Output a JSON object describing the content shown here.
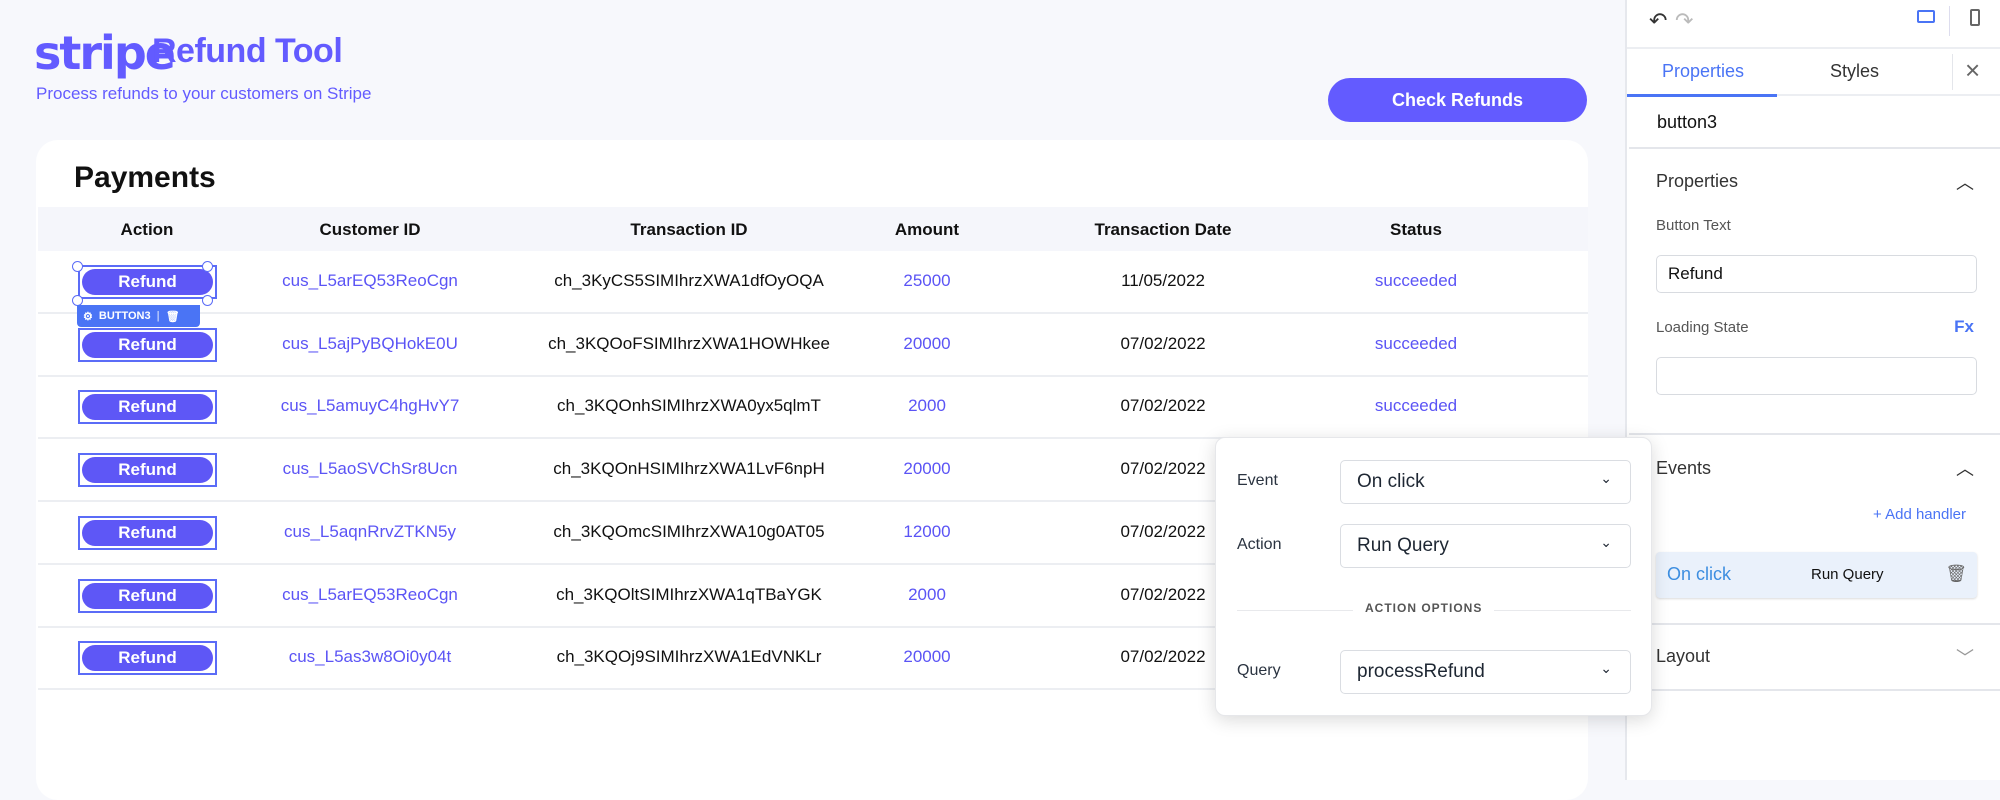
{
  "header": {
    "logo": "stripe",
    "title": "Refund Tool",
    "subtitle": "Process refunds to your customers on Stripe",
    "check_refunds": "Check Refunds"
  },
  "table": {
    "title": "Payments",
    "columns": [
      "Action",
      "Customer ID",
      "Transaction ID",
      "Amount",
      "Transaction Date",
      "Status"
    ],
    "rows": [
      {
        "action": "Refund",
        "customer": "cus_L5arEQ53ReoCgn",
        "txn": "ch_3KyCS5SIMIhrzXWA1dfOyOQA",
        "amount": "25000",
        "date": "11/05/2022",
        "status": "succeeded"
      },
      {
        "action": "Refund",
        "customer": "cus_L5ajPyBQHokE0U",
        "txn": "ch_3KQOoFSIMIhrzXWA1HOWHkee",
        "amount": "20000",
        "date": "07/02/2022",
        "status": "succeeded"
      },
      {
        "action": "Refund",
        "customer": "cus_L5amuyC4hgHvY7",
        "txn": "ch_3KQOnhSIMIhrzXWA0yx5qlmT",
        "amount": "2000",
        "date": "07/02/2022",
        "status": "succeeded"
      },
      {
        "action": "Refund",
        "customer": "cus_L5aoSVChSr8Ucn",
        "txn": "ch_3KQOnHSIMIhrzXWA1LvF6npH",
        "amount": "20000",
        "date": "07/02/2022"
      },
      {
        "action": "Refund",
        "customer": "cus_L5aqnRrvZTKN5y",
        "txn": "ch_3KQOmcSIMIhrzXWA10g0AT05",
        "amount": "12000",
        "date": "07/02/2022"
      },
      {
        "action": "Refund",
        "customer": "cus_L5arEQ53ReoCgn",
        "txn": "ch_3KQOltSIMIhrzXWA1qTBaYGK",
        "amount": "2000",
        "date": "07/02/2022"
      },
      {
        "action": "Refund",
        "customer": "cus_L5as3w8Oi0y04t",
        "txn": "ch_3KQOj9SIMIhrzXWA1EdVNKLr",
        "amount": "20000",
        "date": "07/02/2022"
      }
    ]
  },
  "selection": {
    "badge": "BUTTON3"
  },
  "panel": {
    "tabs": [
      "Properties",
      "Styles"
    ],
    "active_tab": "Properties",
    "component": "button3",
    "properties": {
      "title": "Properties",
      "button_text_label": "Button Text",
      "button_text": "Refund",
      "loading_label": "Loading State",
      "fx": "Fx",
      "loading_value": ""
    },
    "events": {
      "title": "Events",
      "add": "+ Add handler",
      "handler_event": "On click",
      "handler_action": "Run Query"
    },
    "layout": {
      "title": "Layout"
    }
  },
  "popup": {
    "event_label": "Event",
    "event": "On click",
    "action_label": "Action",
    "action": "Run Query",
    "options_title": "ACTION OPTIONS",
    "query_label": "Query",
    "query": "processRefund"
  },
  "colors": {
    "brand": "#635bff",
    "accent": "#4a74f5"
  }
}
